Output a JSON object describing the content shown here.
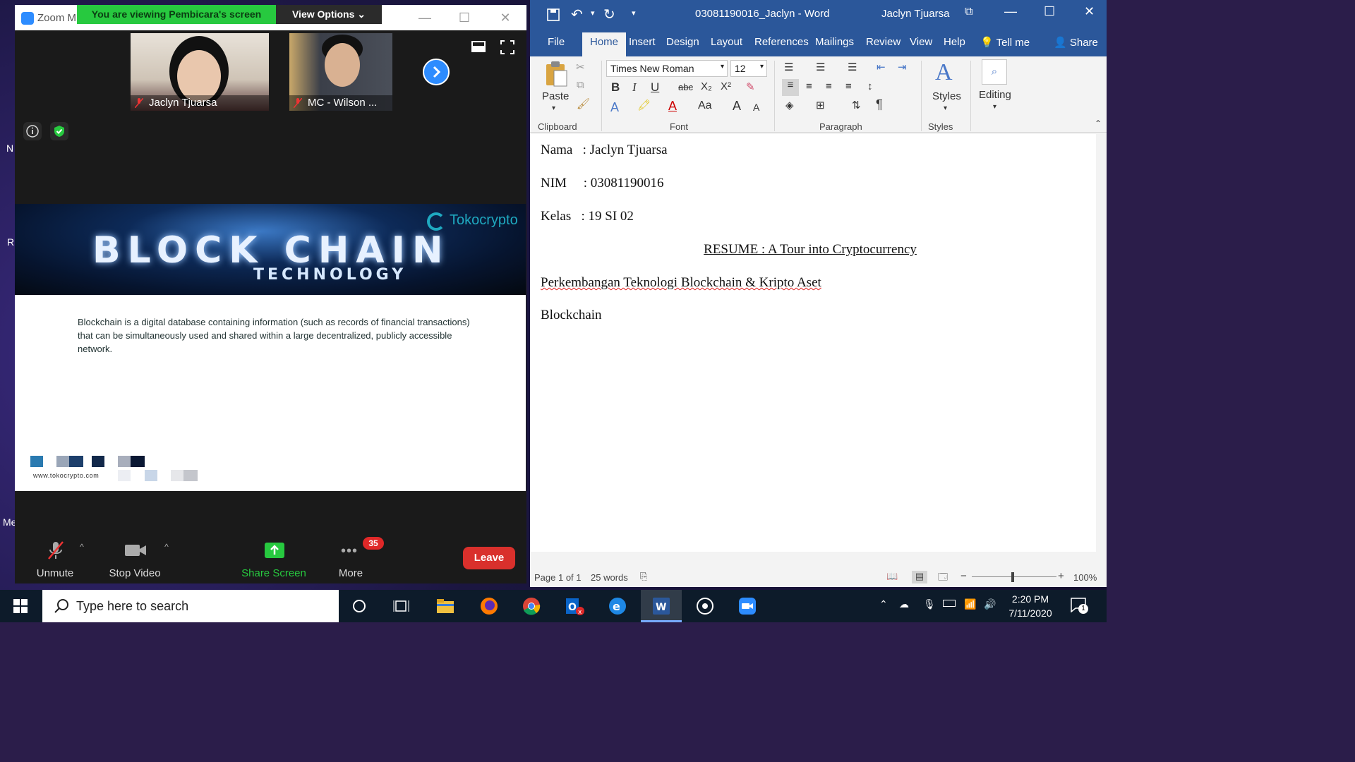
{
  "desktop": {
    "labels": [
      "N",
      "R",
      "Me"
    ]
  },
  "zoom": {
    "window_title": "Zoom M",
    "viewing_banner": "You are viewing Pembicara's screen",
    "view_options_label": "View Options",
    "participants": [
      {
        "name": "Jaclyn Tjuarsa"
      },
      {
        "name": "MC - Wilson ..."
      }
    ],
    "slide": {
      "banner_title": "BLOCK CHAIN",
      "banner_subtitle": "TECHNOLOGY",
      "brand": "Tokocrypto",
      "body_text": "Blockchain is a digital database containing information (such as records of financial transactions) that can be simultaneously used and shared within a large decentralized, publicly accessible network.",
      "url": "www.tokocrypto.com"
    },
    "toolbar": {
      "unmute_label": "Unmute",
      "stop_video_label": "Stop Video",
      "share_screen_label": "Share Screen",
      "more_label": "More",
      "more_badge": "35",
      "leave_label": "Leave"
    },
    "colors": {
      "accent": "#2d8cff",
      "banner_green": "#27c93f",
      "leave_red": "#d9302c"
    }
  },
  "word": {
    "doc_title": "03081190016_Jaclyn  -  Word",
    "user_name": "Jaclyn Tjuarsa",
    "tabs": [
      "File",
      "Home",
      "Insert",
      "Design",
      "Layout",
      "References",
      "Mailings",
      "Review",
      "View",
      "Help",
      "Tell me",
      "Share"
    ],
    "ribbon": {
      "paste_label": "Paste",
      "font_name": "Times New Roman",
      "font_size": "12",
      "styles_label": "Styles",
      "editing_label": "Editing",
      "groups": [
        "Clipboard",
        "Font",
        "Paragraph",
        "Styles"
      ]
    },
    "document": {
      "lines": [
        "Nama   : Jaclyn Tjuarsa",
        "NIM     : 03081190016",
        "Kelas   : 19 SI 02",
        "RESUME : A Tour into Cryptocurrency",
        "Perkembangan Teknologi Blockchain & Kripto Aset",
        "Blockchain"
      ]
    },
    "status": {
      "page": "Page 1 of 1",
      "words": "25 words",
      "zoom": "100%"
    },
    "colors": {
      "brand": "#2b579a"
    }
  },
  "taskbar": {
    "search_placeholder": "Type here to search",
    "time": "2:20 PM",
    "date": "7/11/2020",
    "notification_count": "1",
    "apps": [
      "cortana-icon",
      "task-view-icon",
      "file-explorer-icon",
      "firefox-icon",
      "chrome-icon",
      "outlook-icon",
      "edge-icon",
      "word-icon",
      "media-icon",
      "zoom-icon"
    ]
  }
}
